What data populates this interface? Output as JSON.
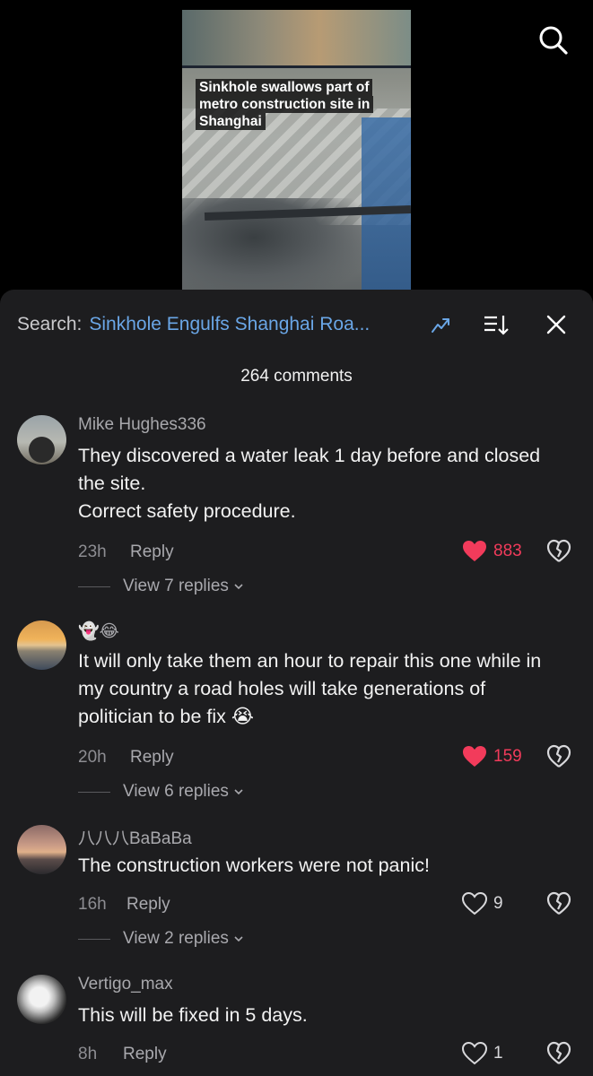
{
  "video": {
    "caption": "Sinkhole swallows part of metro construction site in Shanghai"
  },
  "search": {
    "label": "Search:",
    "term": "Sinkhole Engulfs Shanghai Roa..."
  },
  "comments_count": "264 comments",
  "reply_label": "Reply",
  "accent": {
    "like_red": "#f23b5b",
    "link_blue": "#6aa6e6"
  },
  "comments": [
    {
      "username": "Mike Hughes336",
      "text": "They discovered a water leak 1 day before and closed the site.\nCorrect safety procedure.",
      "time": "23h",
      "likes": "883",
      "liked": true,
      "view_replies": "View 7 replies"
    },
    {
      "username": "👻😂",
      "text": "It will only take them an hour to repair this one while in my country a road holes will take generations of politician to be fix 😭",
      "time": "20h",
      "likes": "159",
      "liked": true,
      "view_replies": "View 6 replies"
    },
    {
      "username": "八八八BaBaBa",
      "text": "The construction workers were not panic!",
      "time": "16h",
      "likes": "9",
      "liked": false,
      "view_replies": "View 2 replies"
    },
    {
      "username": "Vertigo_max",
      "text": "This will be fixed in 5 days.",
      "time": "8h",
      "likes": "1",
      "liked": false
    }
  ]
}
